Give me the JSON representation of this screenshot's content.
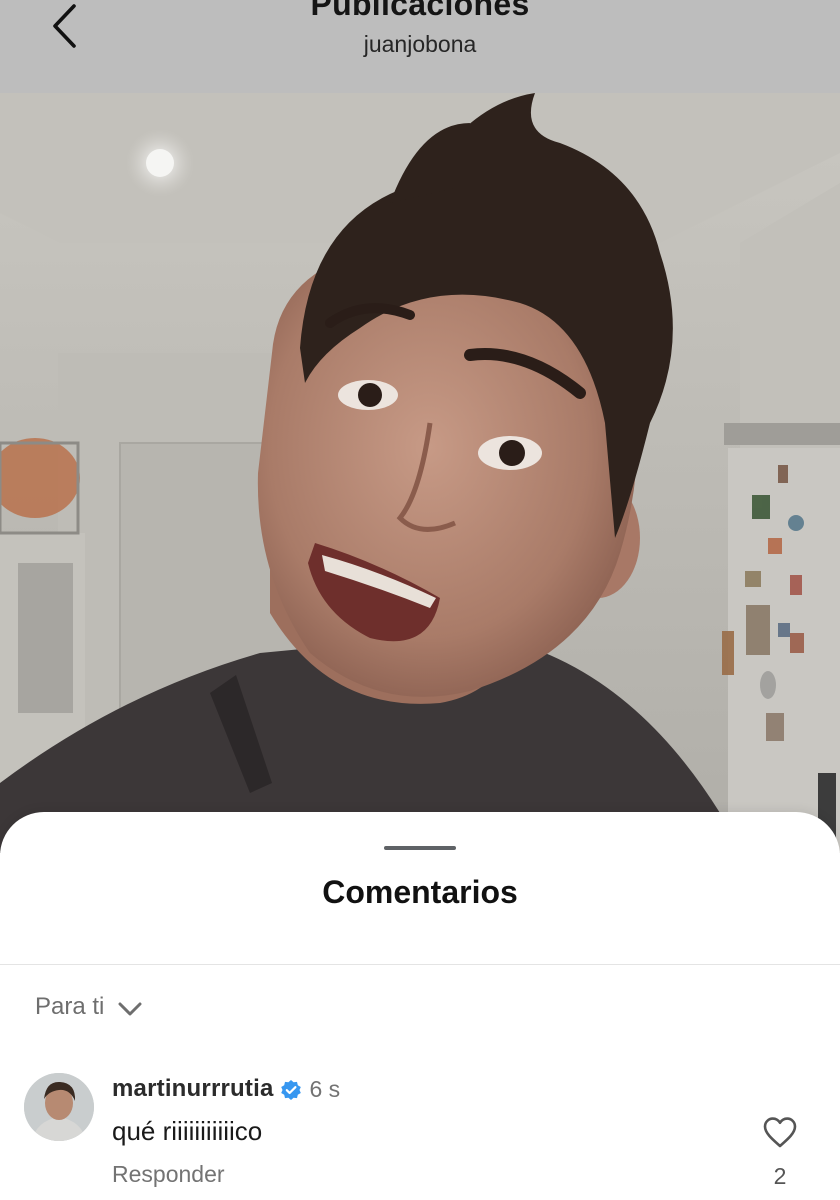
{
  "header": {
    "title": "Publicaciones",
    "username": "juanjobona",
    "back_icon": "chevron-left-icon"
  },
  "colors": {
    "header_bg": "#bdbdbd",
    "sheet_bg": "#ffffff",
    "verified": "#3797f0",
    "muted_text": "#737373"
  },
  "comments_sheet": {
    "title": "Comentarios",
    "filter_label": "Para ti",
    "filter_icon": "chevron-down-icon",
    "comments": [
      {
        "username": "martinurrrutia",
        "verified": true,
        "time": "6 s",
        "text": "qué riiiiiiiiiiico",
        "reply_label": "Responder",
        "like_icon": "heart-outline-icon",
        "likes": "2"
      }
    ]
  }
}
